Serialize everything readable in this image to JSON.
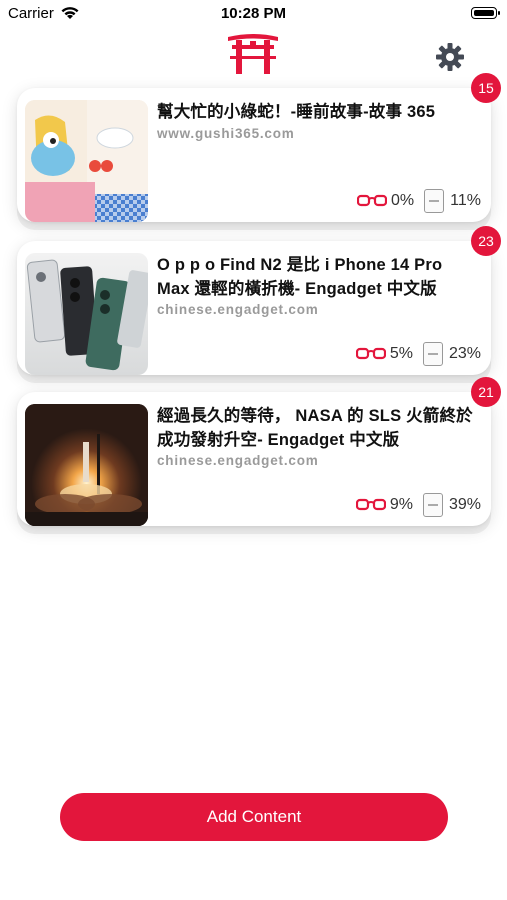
{
  "status_bar": {
    "carrier": "Carrier",
    "time": "10:28 PM"
  },
  "header": {
    "logo_icon": "torii-gate-icon",
    "settings_icon": "gear-icon"
  },
  "colors": {
    "accent": "#e3163c",
    "muted": "#9a9a9a"
  },
  "cards": [
    {
      "title": "幫大忙的小綠蛇！-睡前故事-故事 365",
      "domain": "www.gushi365.com",
      "badge": "15",
      "glasses_pct": "0%",
      "book_pct": "11%"
    },
    {
      "title": "O p p o Find N2 是比 i Phone 14 Pro Max 還輕的橫折機- Engadget 中文版",
      "domain": "chinese.engadget.com",
      "badge": "23",
      "glasses_pct": "5%",
      "book_pct": "23%"
    },
    {
      "title": "經過長久的等待， NASA 的 SLS 火箭終於成功發射升空- Engadget 中文版",
      "domain": "chinese.engadget.com",
      "badge": "21",
      "glasses_pct": "9%",
      "book_pct": "39%"
    }
  ],
  "footer": {
    "add_content_label": "Add Content"
  }
}
